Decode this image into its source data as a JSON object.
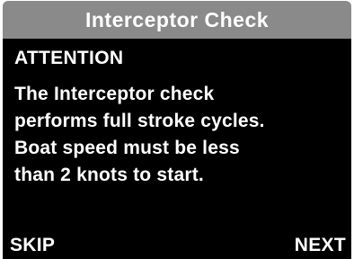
{
  "window": {
    "title": "Interceptor Check"
  },
  "content": {
    "heading": "ATTENTION",
    "message_lines": [
      "The Interceptor check",
      "performs full stroke cycles.",
      "Boat speed must be less",
      "than 2 knots to start."
    ]
  },
  "softkeys": {
    "left_label": "SKIP",
    "right_label": "NEXT"
  },
  "colors": {
    "title_bar": "#8a8a8a",
    "background": "#000000",
    "text": "#ffffff"
  }
}
